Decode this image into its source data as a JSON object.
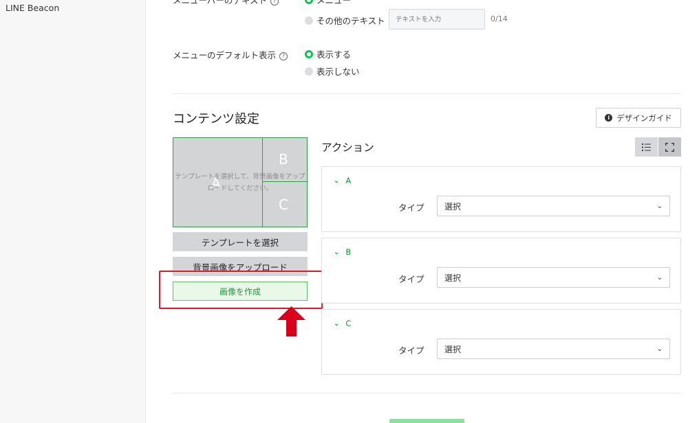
{
  "sidebar": {
    "items": [
      {
        "label": "LINE Beacon"
      }
    ]
  },
  "menu_bar_text": {
    "label": "メニューバーのテキスト",
    "options": [
      {
        "label": "メニュー",
        "selected": true
      },
      {
        "label": "その他のテキスト",
        "selected": false
      }
    ],
    "input_placeholder": "テキストを入力",
    "counter": "0/14"
  },
  "menu_default": {
    "label": "メニューのデフォルト表示",
    "options": [
      {
        "label": "表示する",
        "selected": true
      },
      {
        "label": "表示しない",
        "selected": false
      }
    ]
  },
  "help_icon_glyph": "?",
  "content_settings": {
    "title": "コンテンツ設定",
    "design_guide_label": "デザインガイド",
    "preview": {
      "cells": [
        "A",
        "B",
        "C"
      ],
      "hint": "テンプレートを選択して、背景画像をアップロードしてください。"
    },
    "select_template_label": "テンプレートを選択",
    "upload_bg_label": "背景画像をアップロード",
    "create_image_label": "画像を作成"
  },
  "actions": {
    "title": "アクション",
    "view_icons": [
      "list-icon",
      "expand-icon"
    ],
    "cards": [
      {
        "name": "A",
        "type_label": "タイプ",
        "select_value": "選択"
      },
      {
        "name": "B",
        "type_label": "タイプ",
        "select_value": "選択"
      },
      {
        "name": "C",
        "type_label": "タイプ",
        "select_value": "選択"
      }
    ]
  },
  "colors": {
    "accent_green": "#06c755",
    "highlight_red": "#e5162a",
    "arrow_red": "#d9001b"
  }
}
